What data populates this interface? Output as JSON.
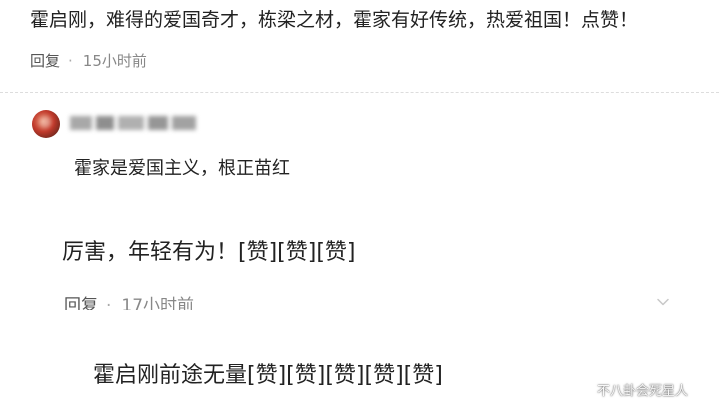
{
  "comment1": {
    "text": "霍启刚，难得的爱国奇才，栋梁之材，霍家有好传统，热爱祖国！点赞！",
    "reply_label": "回复",
    "separator": "·",
    "time": "15小时前"
  },
  "reply": {
    "text": "霍家是爱国主义，根正苗红"
  },
  "comment2": {
    "text": "厉害，年轻有为！[赞][赞][赞]",
    "reply_label": "回复",
    "separator": "·",
    "time": "17小时前"
  },
  "comment3": {
    "text": "霍启刚前途无量[赞][赞][赞][赞][赞]"
  },
  "watermark": {
    "text": "不八卦会死星人"
  }
}
